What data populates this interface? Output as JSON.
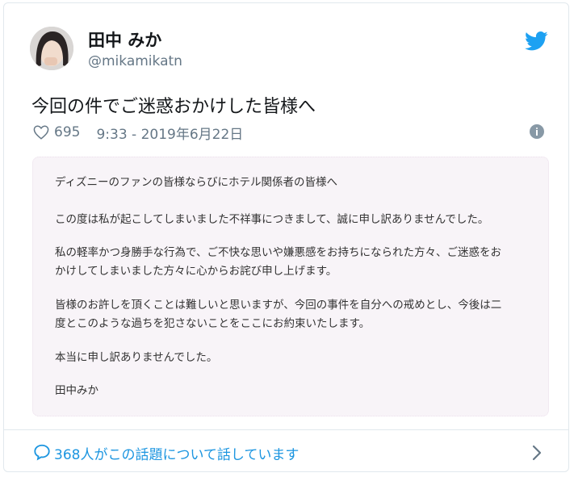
{
  "user": {
    "name": "田中 みか",
    "handle": "@mikamikatn"
  },
  "tweet": {
    "text": "今回の件でご迷惑おかけした皆様へ",
    "likes": "695",
    "timestamp": "9:33 - 2019年6月22日"
  },
  "notice": {
    "p1": "ディズニーのファンの皆様ならびにホテル関係者の皆様へ",
    "p2": "この度は私が起こしてしまいました不祥事につきまして、誠に申し訳ありませんでした。",
    "p3a": "私の軽率かつ身勝手な行為で、ご不快な思いや嫌悪感をお持ちになられた方々、ご迷惑をお",
    "p3b": "かけしてしまいました方々に心からお詫び申し上げます。",
    "p4a": "皆様のお許しを頂くことは難しいと思いますが、今回の事件を自分への戒めとし、今後は二",
    "p4b": "度とこのような過ちを犯さないことをここにお約束いたします。",
    "p5": "本当に申し訳ありませんでした。",
    "signature": "田中みか"
  },
  "footer": {
    "conversation": "368人がこの話題について話しています"
  },
  "colors": {
    "accent": "#1da1f2",
    "secondary_text": "#657786",
    "notice_bg": "#f8f4f8"
  },
  "icons": [
    "twitter-bird-icon",
    "heart-icon",
    "info-icon",
    "reply-bubble-icon",
    "chevron-right-icon"
  ]
}
